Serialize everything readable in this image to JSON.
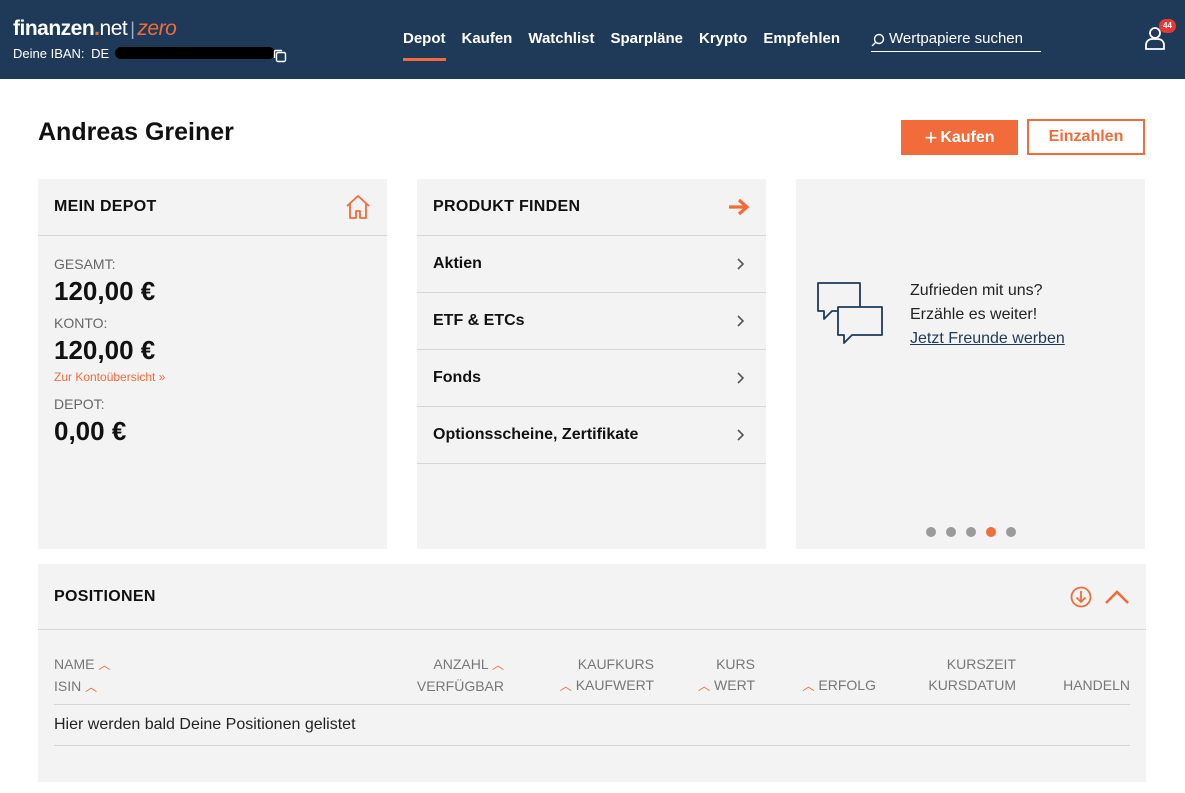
{
  "header": {
    "logo": {
      "brand": "finanzen",
      "dot": ".",
      "net": "net",
      "sep": "|",
      "product": "zero"
    },
    "iban_label": "Deine IBAN:",
    "iban_value": "DE",
    "nav": [
      {
        "label": "Depot",
        "active": true
      },
      {
        "label": "Kaufen"
      },
      {
        "label": "Watchlist"
      },
      {
        "label": "Sparpläne"
      },
      {
        "label": "Krypto"
      },
      {
        "label": "Empfehlen"
      }
    ],
    "search_placeholder": "Wertpapiere suchen",
    "notification_count": "44"
  },
  "page": {
    "title": "Andreas Greiner",
    "buy_label": "Kaufen",
    "buy_plus": "+",
    "deposit_label": "Einzahlen"
  },
  "depot": {
    "title": "MEIN DEPOT",
    "total_label": "GESAMT:",
    "total_value": "120,00 €",
    "account_label": "KONTO:",
    "account_value": "120,00 €",
    "account_link": "Zur Kontoübersicht »",
    "depot_label": "DEPOT:",
    "depot_value": "0,00 €"
  },
  "product": {
    "title": "PRODUKT FINDEN",
    "items": [
      "Aktien",
      "ETF & ETCs",
      "Fonds",
      "Optionsscheine, Zertifikate"
    ]
  },
  "promo": {
    "line1": "Zufrieden mit uns?",
    "line2": "Erzähle es weiter!",
    "link": "Jetzt Freunde werben",
    "active_dot": 4,
    "dot_count": 5
  },
  "positions": {
    "title": "POSITIONEN",
    "columns": {
      "name": "NAME",
      "isin": "ISIN",
      "anzahl": "ANZAHL",
      "verfuegbar": "VERFÜGBAR",
      "kaufkurs": "KAUFKURS",
      "kaufwert": "KAUFWERT",
      "kurs": "KURS",
      "wert": "WERT",
      "erfolg": "ERFOLG",
      "kurszeit": "KURSZEIT",
      "kursdatum": "KURSDATUM",
      "handeln": "HANDELN"
    },
    "empty_message": "Hier werden bald Deine Positionen gelistet"
  },
  "colors": {
    "header_bg": "#1f3a58",
    "accent": "#f26b3a",
    "card_bg": "#f3f3f3"
  }
}
